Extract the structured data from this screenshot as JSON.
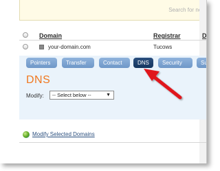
{
  "search_hint": "Search for new",
  "table": {
    "headers": {
      "domain": "Domain",
      "registrar": "Registrar",
      "third": "D"
    },
    "row": {
      "domain": "your-domain.com",
      "registrar": "Tucows"
    }
  },
  "tabs": [
    {
      "label": "Pointers"
    },
    {
      "label": "Transfer"
    },
    {
      "label": "Contact"
    },
    {
      "label": "DNS",
      "active": true
    },
    {
      "label": "Security"
    },
    {
      "label": "Sub"
    }
  ],
  "panel": {
    "title": "DNS",
    "modify_label": "Modify:",
    "select_value": "-- Select below --"
  },
  "footer": {
    "link": "Modify Selected Domains"
  },
  "colors": {
    "accent_orange": "#f07820",
    "tab_blue": "#7ba2d0",
    "tab_active": "#1c3d6b",
    "arrow_red": "#e0141c",
    "panel_bg": "#eaf3fb"
  }
}
